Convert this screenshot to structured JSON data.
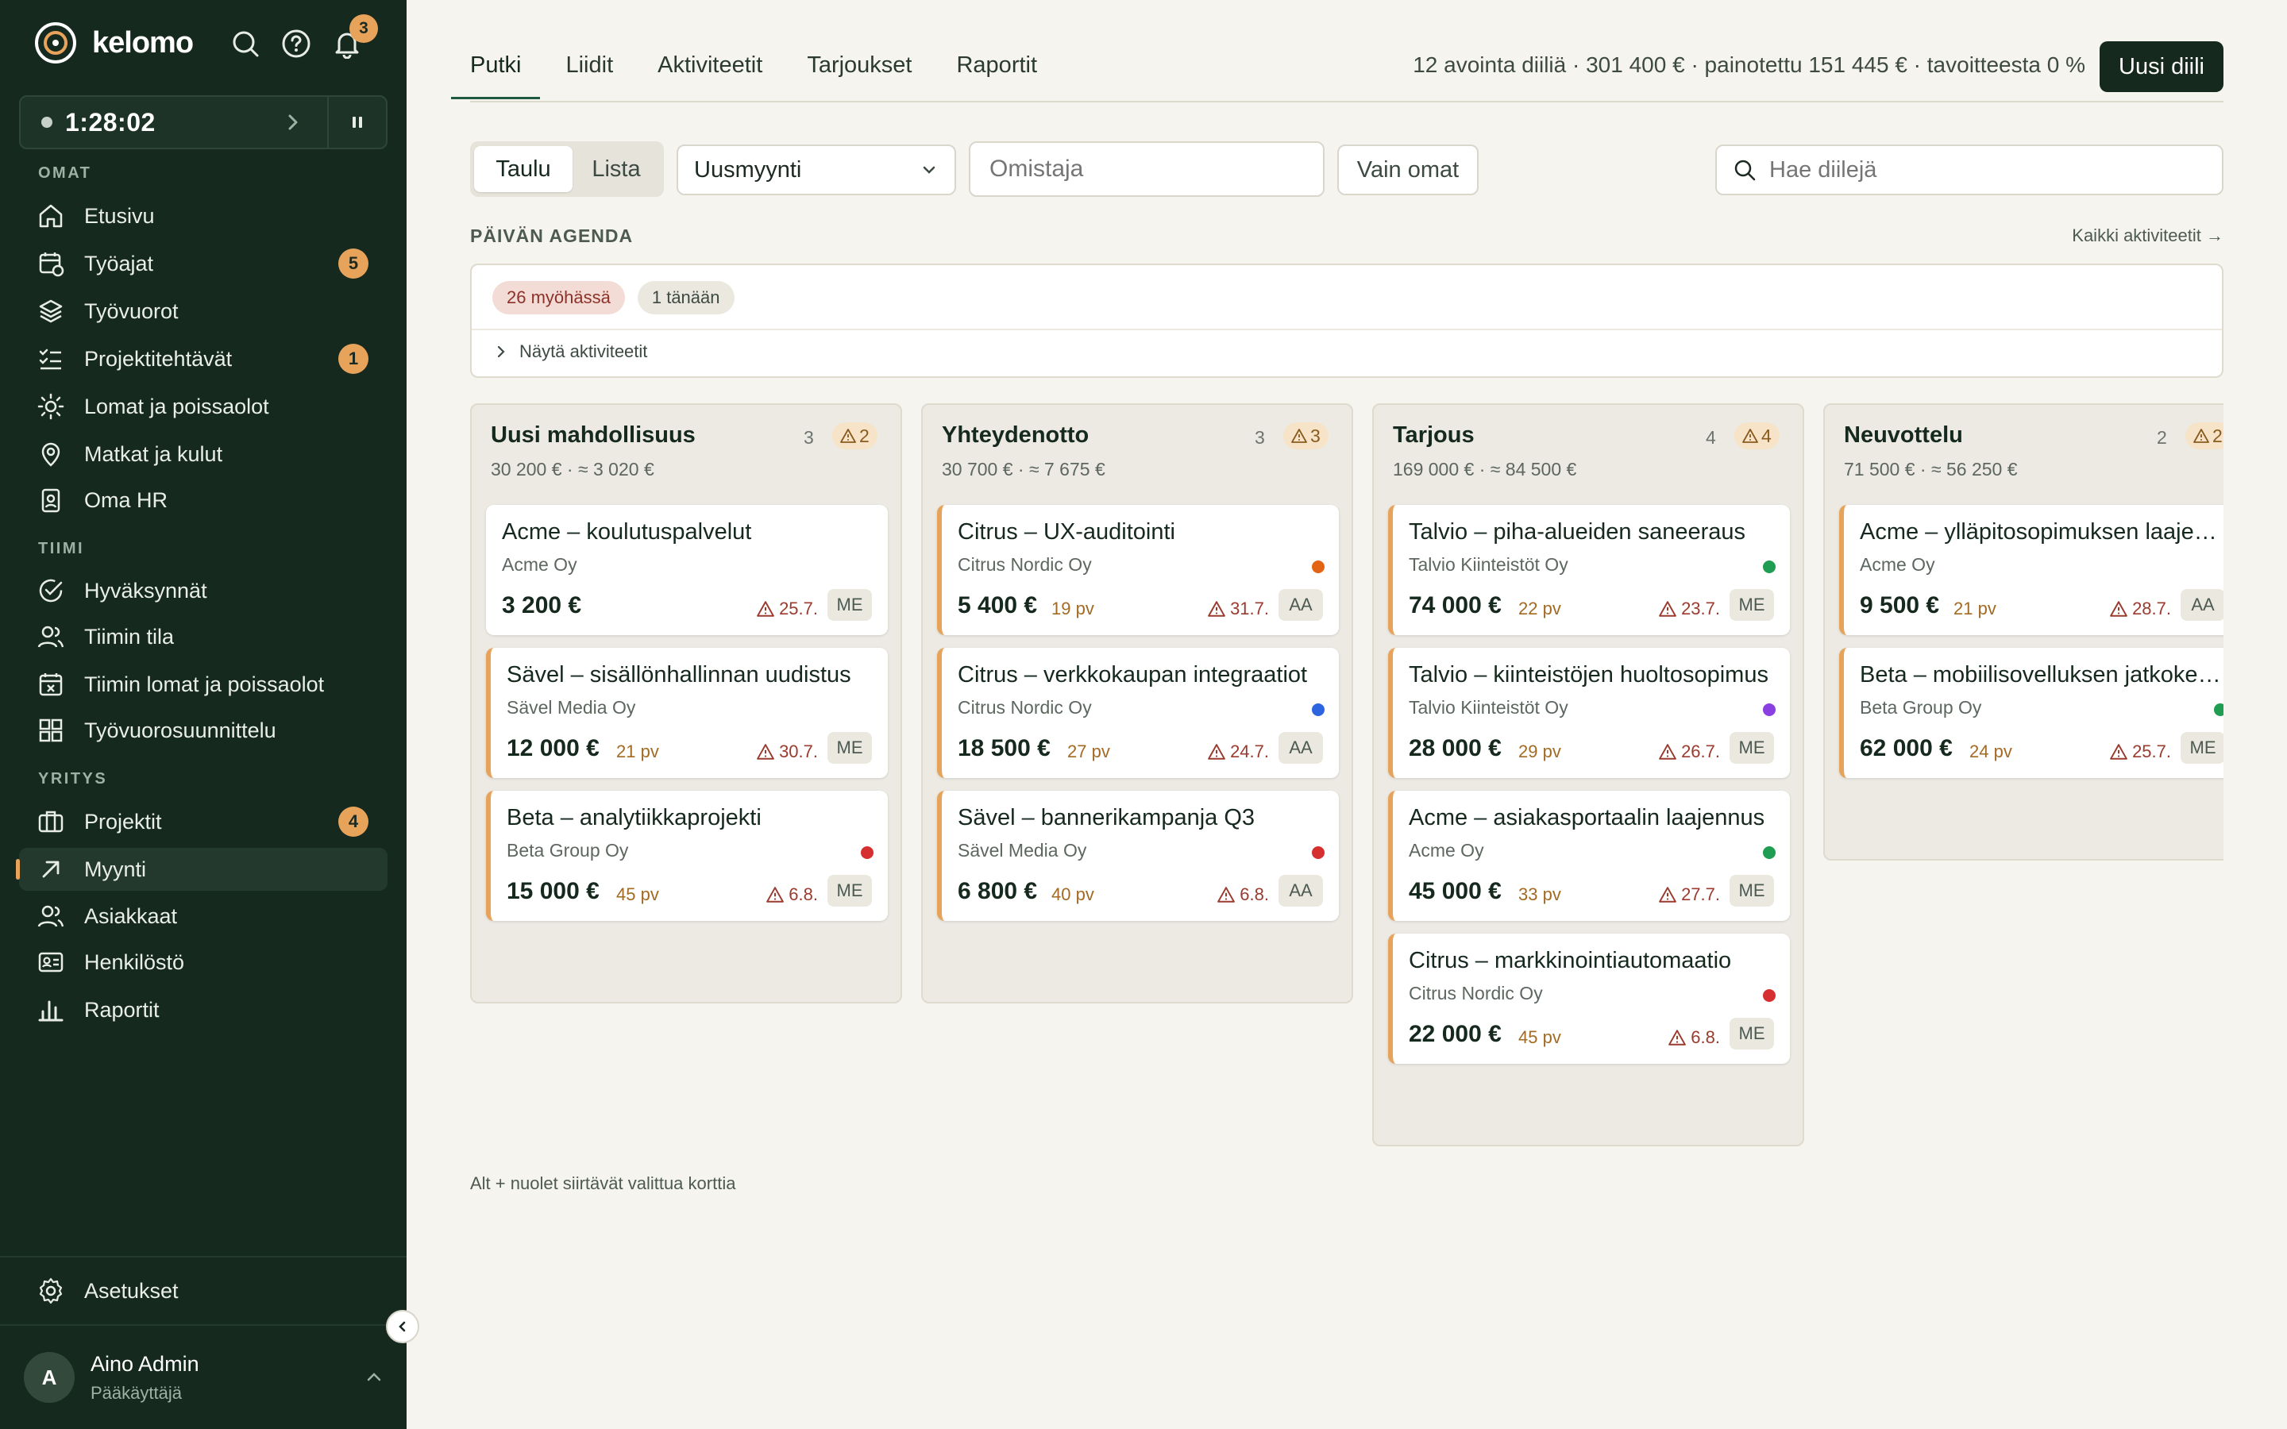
{
  "app": {
    "name": "kelomo",
    "notifications": "3"
  },
  "timer": {
    "value": "1:28:02"
  },
  "sidebar": {
    "sections": {
      "own": "OMAT",
      "team": "TIIMI",
      "company": "YRITYS"
    },
    "items": [
      {
        "label": "Etusivu",
        "icon": "home-icon"
      },
      {
        "label": "Työajat",
        "icon": "calendar-clock-icon",
        "badge": "5"
      },
      {
        "label": "Työvuorot",
        "icon": "layers-icon"
      },
      {
        "label": "Projektitehtävät",
        "icon": "checklist-icon",
        "badge": "1"
      },
      {
        "label": "Lomat ja poissaolot",
        "icon": "sun-icon"
      },
      {
        "label": "Matkat ja kulut",
        "icon": "map-pin-icon"
      },
      {
        "label": "Oma HR",
        "icon": "id-badge-icon"
      },
      {
        "label": "Hyväksynnät",
        "icon": "check-circle-icon"
      },
      {
        "label": "Tiimin tila",
        "icon": "users-icon"
      },
      {
        "label": "Tiimin lomat ja poissaolot",
        "icon": "calendar-x-icon"
      },
      {
        "label": "Työvuorosuunnittelu",
        "icon": "grid-icon"
      },
      {
        "label": "Projektit",
        "icon": "briefcase-icon",
        "badge": "4"
      },
      {
        "label": "Myynti",
        "icon": "arrow-up-right-icon",
        "active": true
      },
      {
        "label": "Asiakkaat",
        "icon": "users-icon"
      },
      {
        "label": "Henkilöstö",
        "icon": "id-card-icon"
      },
      {
        "label": "Raportit",
        "icon": "bar-chart-icon"
      }
    ],
    "settings": "Asetukset"
  },
  "user": {
    "initial": "A",
    "name": "Aino Admin",
    "role": "Pääkäyttäjä"
  },
  "tabs": [
    "Putki",
    "Liidit",
    "Aktiviteetit",
    "Tarjoukset",
    "Raportit"
  ],
  "summary": "12 avointa diiliä · 301 400 € · painotettu 151 445 € · tavoitteesta 0 %",
  "new_deal": "Uusi diili",
  "view_toggle": {
    "board": "Taulu",
    "list": "Lista"
  },
  "filters": {
    "pipeline": "Uusmyynti",
    "owner_placeholder": "Omistaja",
    "only_mine": "Vain omat",
    "search_placeholder": "Hae diilejä"
  },
  "agenda": {
    "title": "PÄIVÄN AGENDA",
    "all_link": "Kaikki aktiviteetit →",
    "late": "26 myöhässä",
    "today": "1 tänään",
    "toggle": "Näytä aktiviteetit"
  },
  "columns": [
    {
      "title": "Uusi mahdollisuus",
      "count": "3",
      "warn": "2",
      "sum": "30 200 €",
      "weighted": "≈ 3 020 €",
      "cards": [
        {
          "title": "Acme – koulutuspalvelut",
          "company": "Acme Oy",
          "value": "3 200 €",
          "age": "",
          "warn": "25.7.",
          "initials": "ME",
          "dot": "",
          "hl": false
        },
        {
          "title": "Sävel – sisällönhallinnan uudistus",
          "company": "Sävel Media Oy",
          "value": "12 000 €",
          "age": "21 pv",
          "warn": "30.7.",
          "initials": "ME",
          "dot": "",
          "hl": true
        },
        {
          "title": "Beta – analytiikkaprojekti",
          "company": "Beta Group Oy",
          "value": "15 000 €",
          "age": "45 pv",
          "warn": "6.8.",
          "initials": "ME",
          "dot": "#d62f2f",
          "hl": true
        }
      ]
    },
    {
      "title": "Yhteydenotto",
      "count": "3",
      "warn": "3",
      "sum": "30 700 €",
      "weighted": "≈ 7 675 €",
      "cards": [
        {
          "title": "Citrus – UX-auditointi",
          "company": "Citrus Nordic Oy",
          "value": "5 400 €",
          "age": "19 pv",
          "warn": "31.7.",
          "initials": "AA",
          "dot": "#e36414",
          "hl": true
        },
        {
          "title": "Citrus – verkkokaupan integraatiot",
          "company": "Citrus Nordic Oy",
          "value": "18 500 €",
          "age": "27 pv",
          "warn": "24.7.",
          "initials": "AA",
          "dot": "#2d64e0",
          "hl": true
        },
        {
          "title": "Sävel – bannerikampanja Q3",
          "company": "Sävel Media Oy",
          "value": "6 800 €",
          "age": "40 pv",
          "warn": "6.8.",
          "initials": "AA",
          "dot": "#d62f2f",
          "hl": true
        }
      ]
    },
    {
      "title": "Tarjous",
      "count": "4",
      "warn": "4",
      "sum": "169 000 €",
      "weighted": "≈ 84 500 €",
      "cards": [
        {
          "title": "Talvio – piha-alueiden saneeraus",
          "company": "Talvio Kiinteistöt Oy",
          "value": "74 000 €",
          "age": "22 pv",
          "warn": "23.7.",
          "initials": "ME",
          "dot": "#1f9d52",
          "hl": true
        },
        {
          "title": "Talvio – kiinteistöjen huoltosopimus",
          "company": "Talvio Kiinteistöt Oy",
          "value": "28 000 €",
          "age": "29 pv",
          "warn": "26.7.",
          "initials": "ME",
          "dot": "#8a3fe0",
          "hl": true
        },
        {
          "title": "Acme – asiakasportaalin laajennus",
          "company": "Acme Oy",
          "value": "45 000 €",
          "age": "33 pv",
          "warn": "27.7.",
          "initials": "ME",
          "dot": "#1f9d52",
          "hl": true
        },
        {
          "title": "Citrus – markkinointiautomaatio",
          "company": "Citrus Nordic Oy",
          "value": "22 000 €",
          "age": "45 pv",
          "warn": "6.8.",
          "initials": "ME",
          "dot": "#d62f2f",
          "hl": true
        }
      ]
    },
    {
      "title": "Neuvottelu",
      "count": "2",
      "warn": "2",
      "sum": "71 500 €",
      "weighted": "≈ 56 250 €",
      "cards": [
        {
          "title": "Acme – ylläpitosopimuksen laajennus",
          "company": "Acme Oy",
          "value": "9 500 €",
          "age": "21 pv",
          "warn": "28.7.",
          "initials": "AA",
          "dot": "",
          "hl": true
        },
        {
          "title": "Beta – mobiilisovelluksen jatkokehitys",
          "company": "Beta Group Oy",
          "value": "62 000 €",
          "age": "24 pv",
          "warn": "25.7.",
          "initials": "ME",
          "dot": "#1f9d52",
          "hl": true
        }
      ]
    }
  ],
  "hint": "Alt + nuolet siirtävät valittua korttia"
}
